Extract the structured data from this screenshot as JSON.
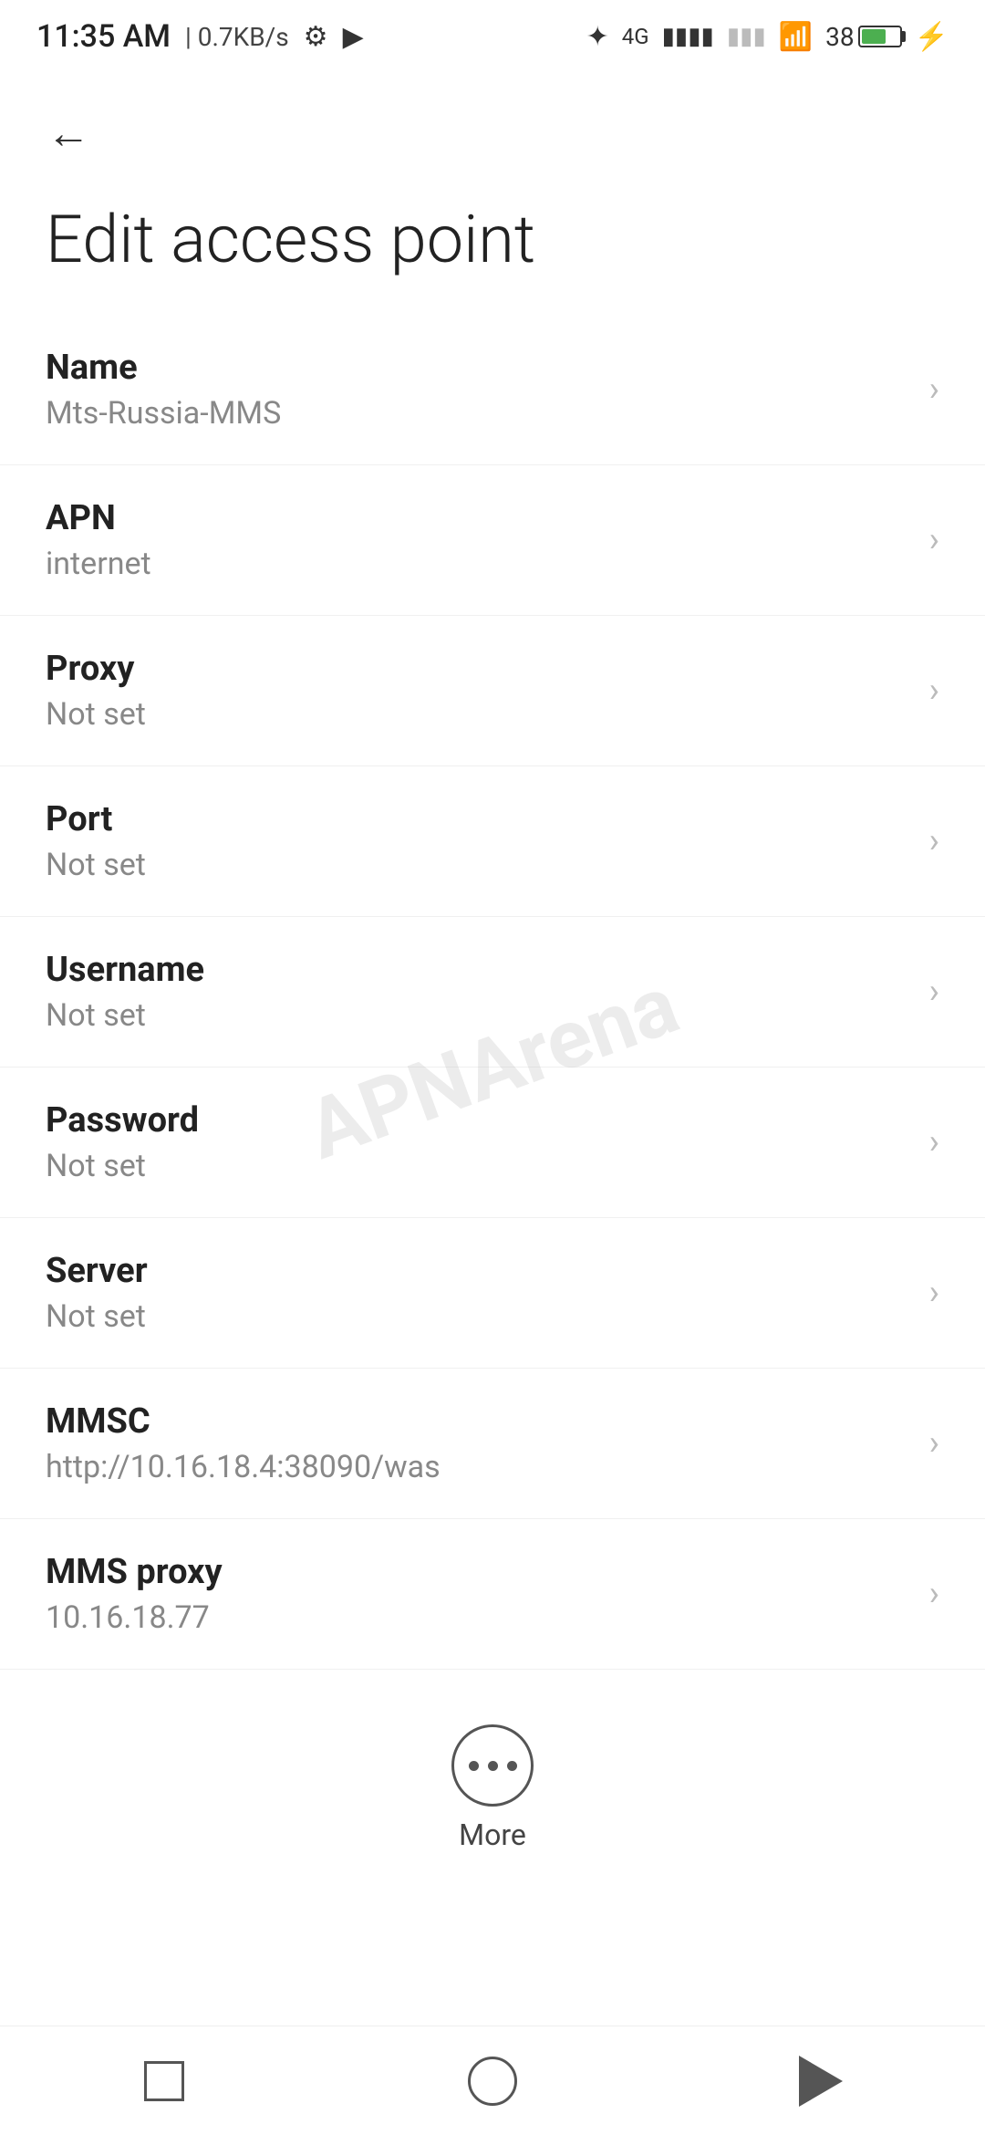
{
  "statusBar": {
    "time": "11:35 AM",
    "speed": "0.7KB/s"
  },
  "page": {
    "title": "Edit access point",
    "backLabel": "Back"
  },
  "settings": [
    {
      "label": "Name",
      "value": "Mts-Russia-MMS"
    },
    {
      "label": "APN",
      "value": "internet"
    },
    {
      "label": "Proxy",
      "value": "Not set"
    },
    {
      "label": "Port",
      "value": "Not set"
    },
    {
      "label": "Username",
      "value": "Not set"
    },
    {
      "label": "Password",
      "value": "Not set"
    },
    {
      "label": "Server",
      "value": "Not set"
    },
    {
      "label": "MMSC",
      "value": "http://10.16.18.4:38090/was"
    },
    {
      "label": "MMS proxy",
      "value": "10.16.18.77"
    }
  ],
  "more": {
    "label": "More"
  },
  "watermark": "APNArena"
}
